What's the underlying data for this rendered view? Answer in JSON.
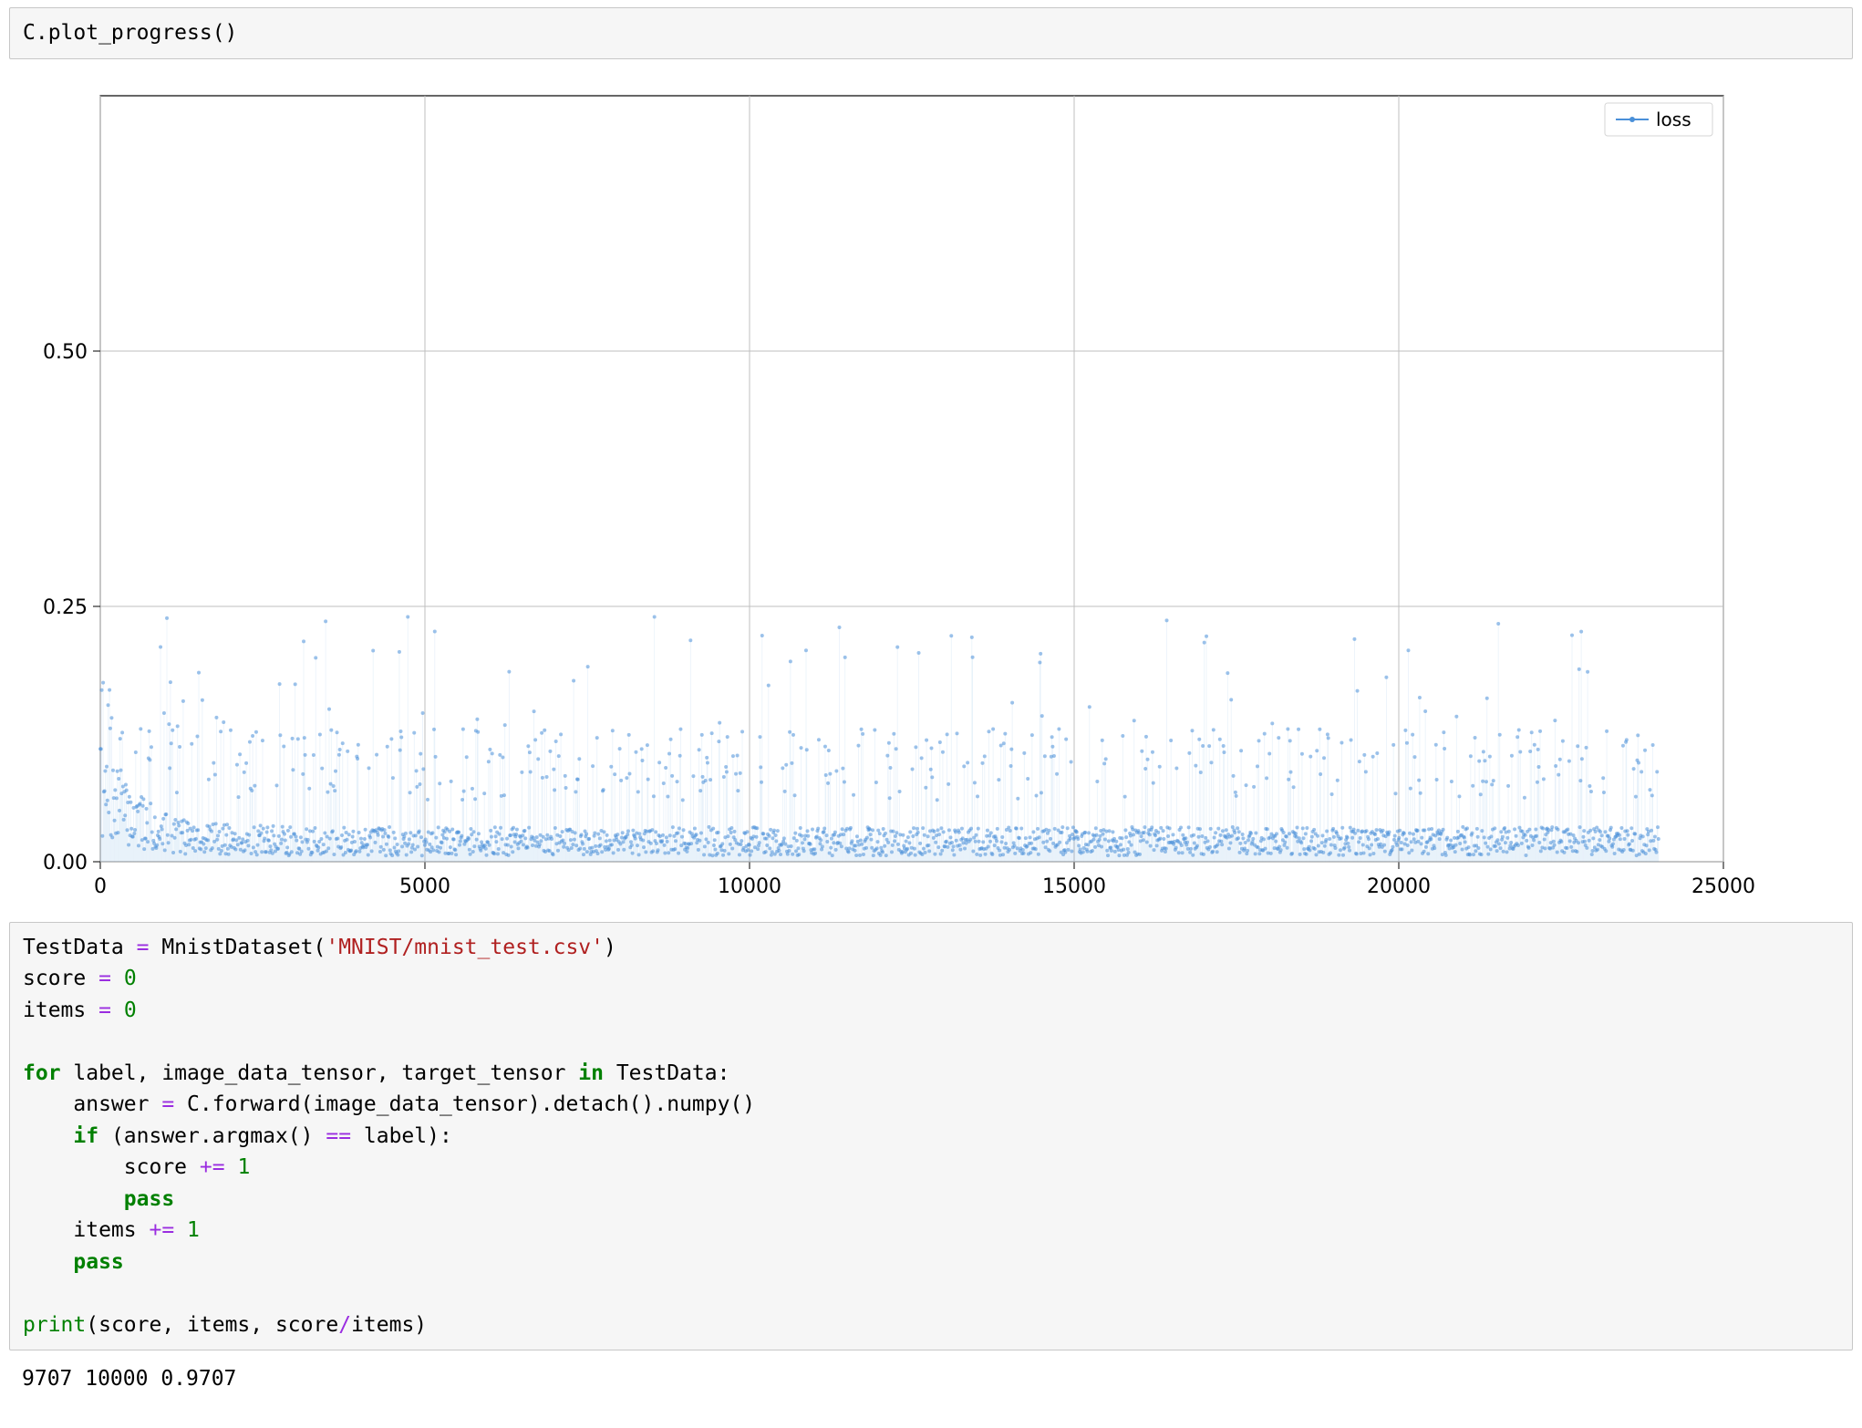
{
  "cell1": {
    "code": "C.plot_progress()"
  },
  "chart_data": {
    "type": "scatter",
    "title": "",
    "xlabel": "",
    "ylabel": "",
    "xlim": [
      0,
      25000
    ],
    "ylim": [
      0.0,
      0.75
    ],
    "xticks": [
      0,
      5000,
      10000,
      15000,
      20000,
      25000
    ],
    "yticks": [
      0.0,
      0.25,
      0.5
    ],
    "legend": {
      "position": "top-right",
      "entries": [
        "loss"
      ]
    },
    "series": [
      {
        "name": "loss",
        "color": "#4a90d9",
        "n_points_approx": 24000,
        "x_range": [
          0,
          24000
        ],
        "y_typical_range": [
          0.0,
          0.15
        ],
        "y_max_spikes_approx": 0.25,
        "description": "Dense scatter of ~24000 training-loss points; most mass lies between 0.00 and 0.10 with frequent spikes up to ~0.20–0.25, relatively flat across x."
      }
    ]
  },
  "cell2": {
    "tokens": [
      [
        [
          "",
          "TestData "
        ],
        [
          "op",
          "="
        ],
        [
          "",
          " MnistDataset("
        ],
        [
          "str",
          "'MNIST/mnist_test.csv'"
        ],
        [
          "",
          ")"
        ]
      ],
      [
        [
          "",
          "score "
        ],
        [
          "op",
          "="
        ],
        [
          "",
          " "
        ],
        [
          "num",
          "0"
        ]
      ],
      [
        [
          "",
          "items "
        ],
        [
          "op",
          "="
        ],
        [
          "",
          " "
        ],
        [
          "num",
          "0"
        ]
      ],
      [
        [
          "",
          ""
        ]
      ],
      [
        [
          "kw",
          "for"
        ],
        [
          "",
          " label, image_data_tensor, target_tensor "
        ],
        [
          "kw",
          "in"
        ],
        [
          "",
          " TestData:"
        ]
      ],
      [
        [
          "",
          "    answer "
        ],
        [
          "op",
          "="
        ],
        [
          "",
          " C.forward(image_data_tensor).detach().numpy()"
        ]
      ],
      [
        [
          "",
          "    "
        ],
        [
          "kw",
          "if"
        ],
        [
          "",
          " (answer.argmax() "
        ],
        [
          "op",
          "=="
        ],
        [
          "",
          " label):"
        ]
      ],
      [
        [
          "",
          "        score "
        ],
        [
          "op",
          "+="
        ],
        [
          "",
          " "
        ],
        [
          "num",
          "1"
        ]
      ],
      [
        [
          "",
          "        "
        ],
        [
          "kw",
          "pass"
        ]
      ],
      [
        [
          "",
          "    items "
        ],
        [
          "op",
          "+="
        ],
        [
          "",
          " "
        ],
        [
          "num",
          "1"
        ]
      ],
      [
        [
          "",
          "    "
        ],
        [
          "kw",
          "pass"
        ]
      ],
      [
        [
          "",
          ""
        ]
      ],
      [
        [
          "bi",
          "print"
        ],
        [
          "",
          "(score, items, score"
        ],
        [
          "op",
          "/"
        ],
        [
          "",
          "items)"
        ]
      ]
    ]
  },
  "output": {
    "text": "9707 10000 0.9707"
  }
}
